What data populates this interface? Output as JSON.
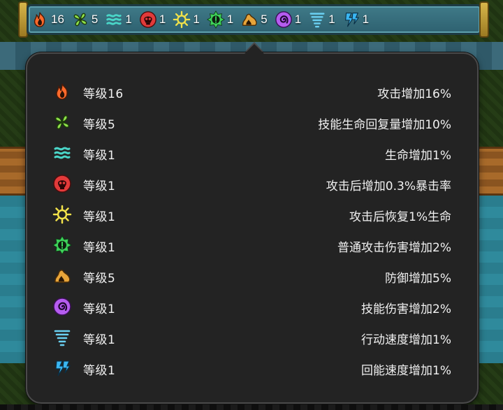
{
  "top_bar": {
    "buffs": [
      {
        "icon": "fire-icon",
        "count": "16",
        "color": "#ff6a2b"
      },
      {
        "icon": "clover-icon",
        "count": "5",
        "color": "#8ee04a"
      },
      {
        "icon": "waves-icon",
        "count": "1",
        "color": "#4ad6c8"
      },
      {
        "icon": "skull-icon",
        "count": "1",
        "color": "#e23a3a"
      },
      {
        "icon": "sun-icon",
        "count": "1",
        "color": "#f2e24a"
      },
      {
        "icon": "gear-sun-icon",
        "count": "1",
        "color": "#3ed15a"
      },
      {
        "icon": "rock-icon",
        "count": "5",
        "color": "#e8a53a"
      },
      {
        "icon": "spiral-icon",
        "count": "1",
        "color": "#b55cf0"
      },
      {
        "icon": "tornado-icon",
        "count": "1",
        "color": "#6ad0f2"
      },
      {
        "icon": "lightning-icon",
        "count": "1",
        "color": "#3ab6f2"
      }
    ]
  },
  "panel": {
    "rows": [
      {
        "icon": "fire-icon",
        "level": "等级16",
        "effect": "攻击增加16%"
      },
      {
        "icon": "clover-icon",
        "level": "等级5",
        "effect": "技能生命回复量增加10%"
      },
      {
        "icon": "waves-icon",
        "level": "等级1",
        "effect": "生命增加1%"
      },
      {
        "icon": "skull-icon",
        "level": "等级1",
        "effect": "攻击后增加0.3%暴击率"
      },
      {
        "icon": "sun-icon",
        "level": "等级1",
        "effect": "攻击后恢复1%生命"
      },
      {
        "icon": "gear-sun-icon",
        "level": "等级1",
        "effect": "普通攻击伤害增加2%"
      },
      {
        "icon": "rock-icon",
        "level": "等级5",
        "effect": "防御增加5%"
      },
      {
        "icon": "spiral-icon",
        "level": "等级1",
        "effect": "技能伤害增加2%"
      },
      {
        "icon": "tornado-icon",
        "level": "等级1",
        "effect": "行动速度增加1%"
      },
      {
        "icon": "lightning-icon",
        "level": "等级1",
        "effect": "回能速度增加1%"
      }
    ]
  }
}
